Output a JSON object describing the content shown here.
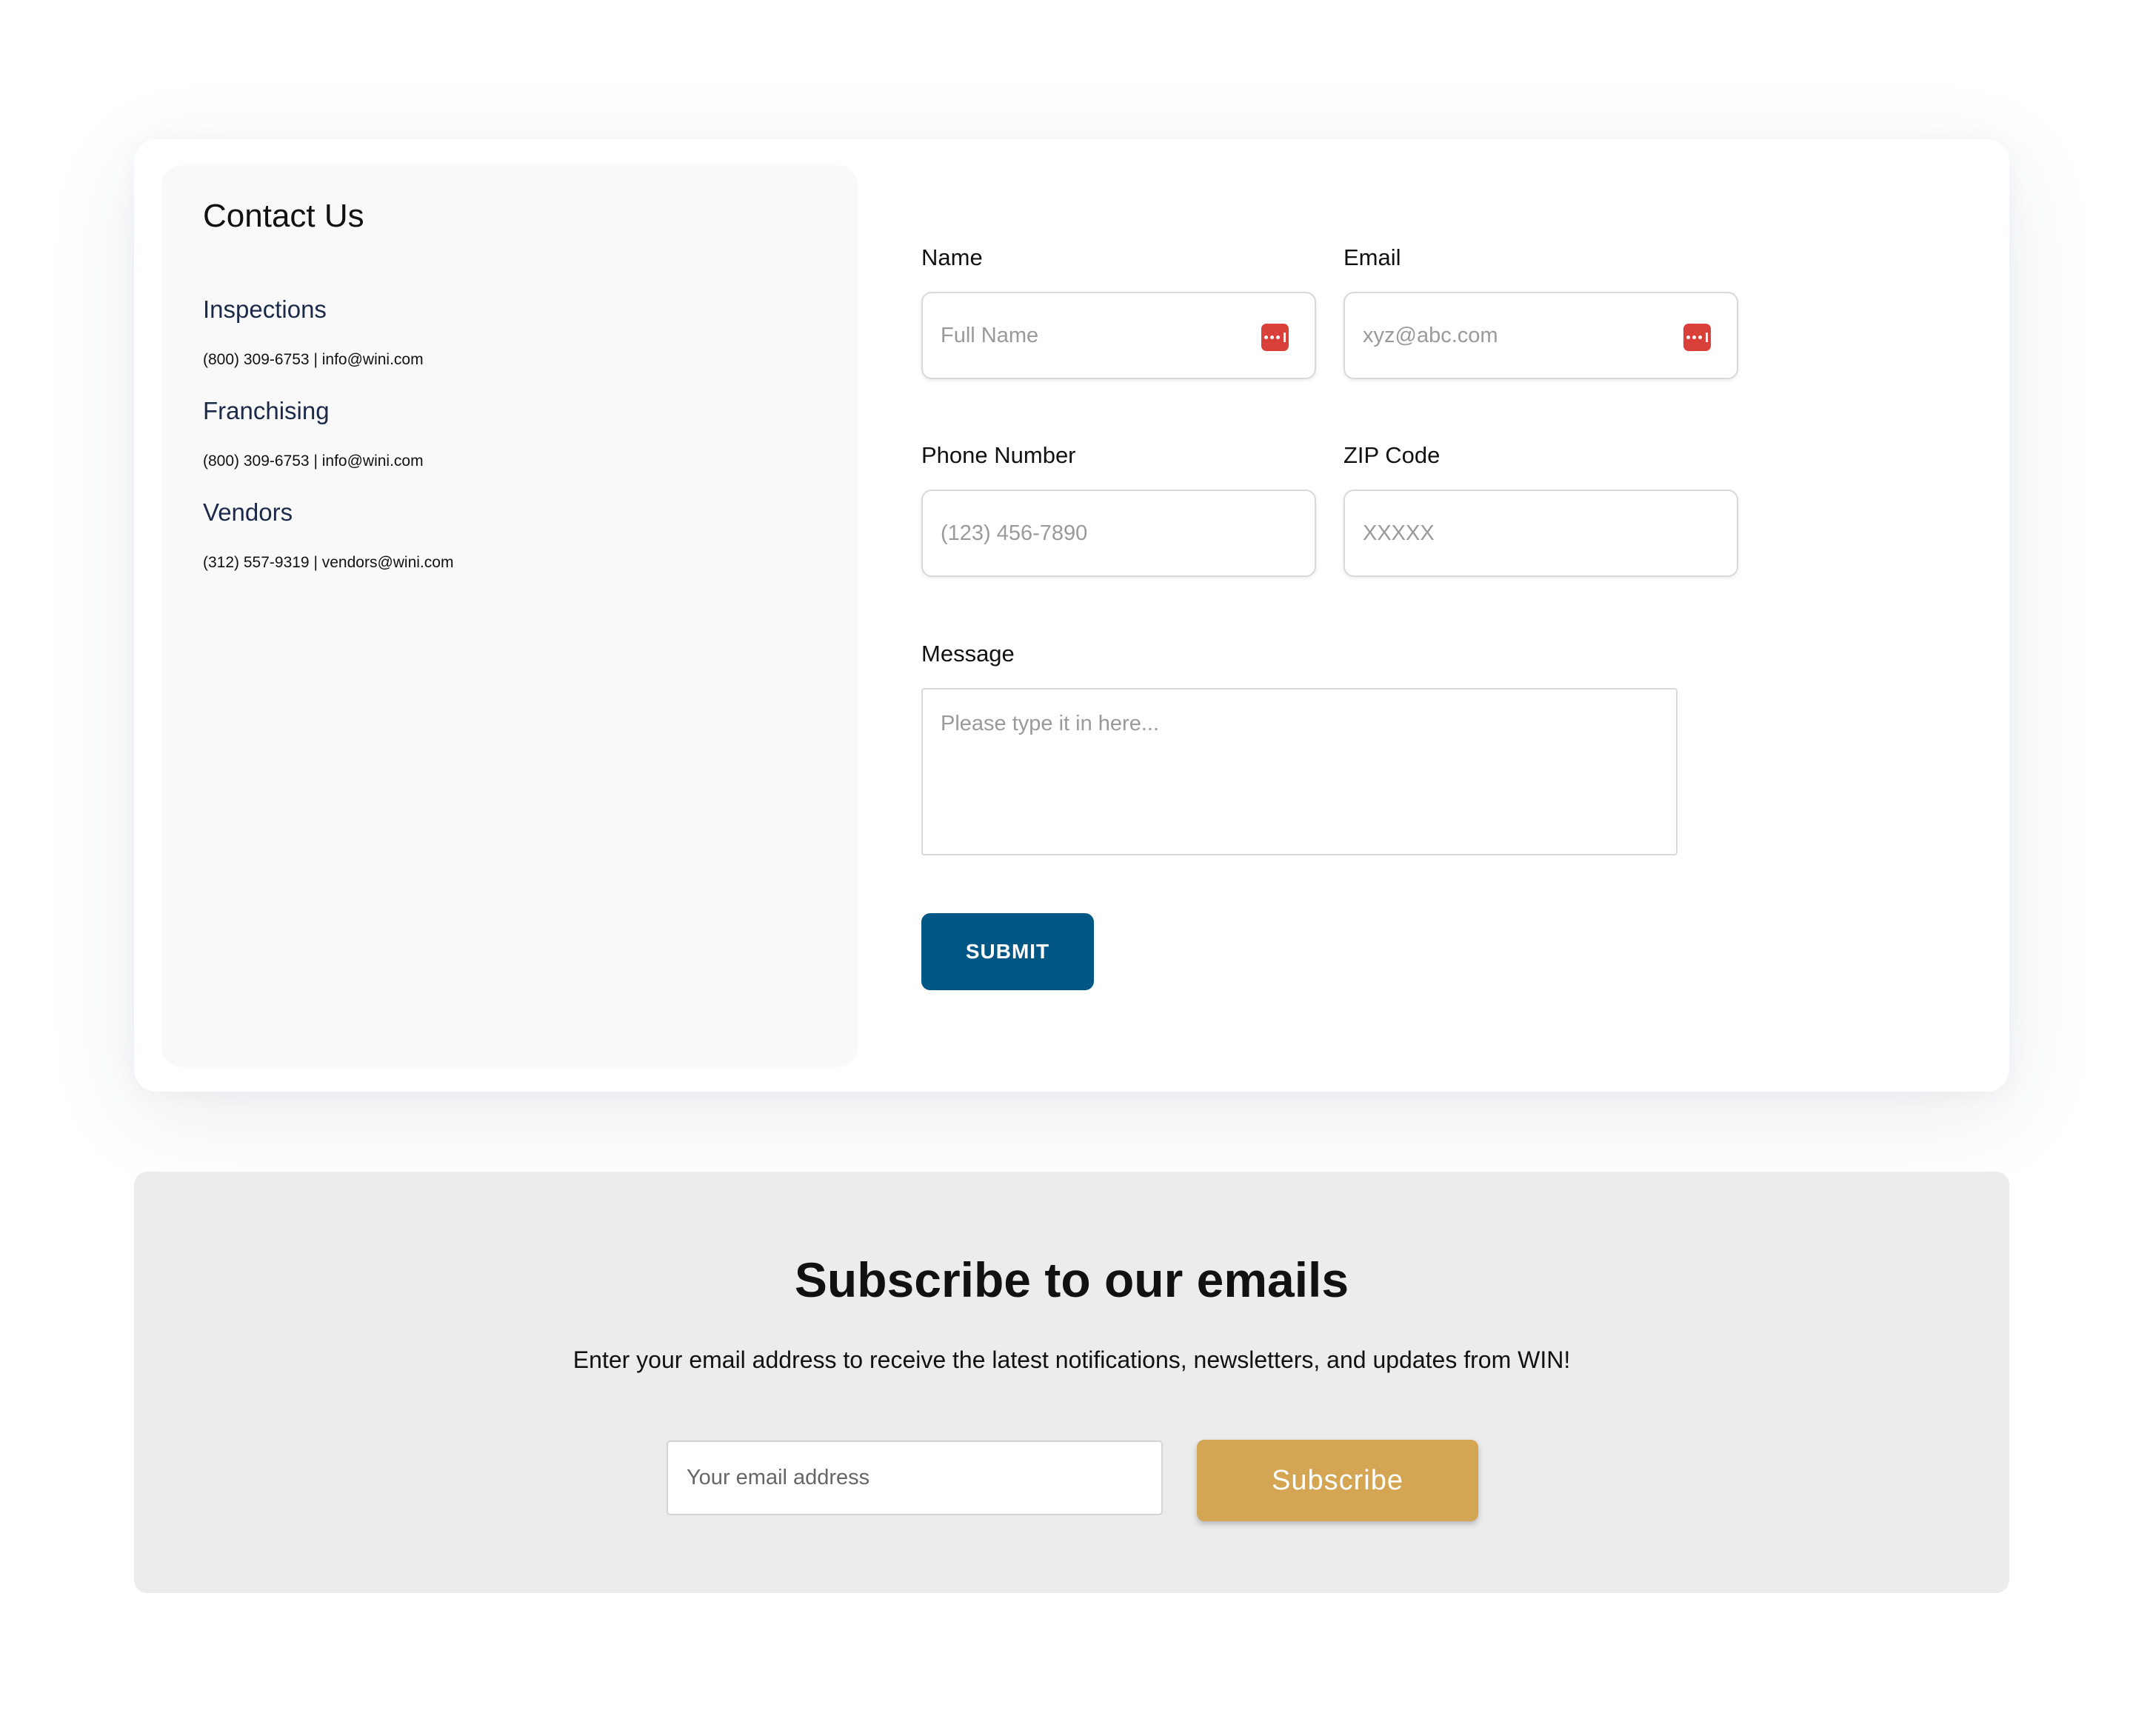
{
  "contact": {
    "title": "Contact Us",
    "groups": [
      {
        "title": "Inspections",
        "detail": "(800) 309-6753 | info@wini.com"
      },
      {
        "title": "Franchising",
        "detail": "(800) 309-6753 | info@wini.com"
      },
      {
        "title": "Vendors",
        "detail": "(312) 557-9319 | vendors@wini.com"
      }
    ]
  },
  "form": {
    "name": {
      "label": "Name",
      "placeholder": "Full Name"
    },
    "email": {
      "label": "Email",
      "placeholder": "xyz@abc.com"
    },
    "phone": {
      "label": "Phone Number",
      "placeholder": "(123) 456-7890"
    },
    "zip": {
      "label": "ZIP Code",
      "placeholder": "XXXXX"
    },
    "message": {
      "label": "Message",
      "placeholder": "Please type it in here..."
    },
    "submit_label": "SUBMIT"
  },
  "subscribe": {
    "title": "Subscribe to our emails",
    "description": "Enter your email address to receive the latest notifications, newsletters, and updates from WIN!",
    "input_placeholder": "Your email address",
    "button_label": "Subscribe"
  },
  "colors": {
    "primary_button": "#005785",
    "subscribe_button": "#d4a653",
    "password_manager_icon": "#d9403a"
  },
  "icons": {
    "field_autofill_icon": "password-manager-icon"
  }
}
